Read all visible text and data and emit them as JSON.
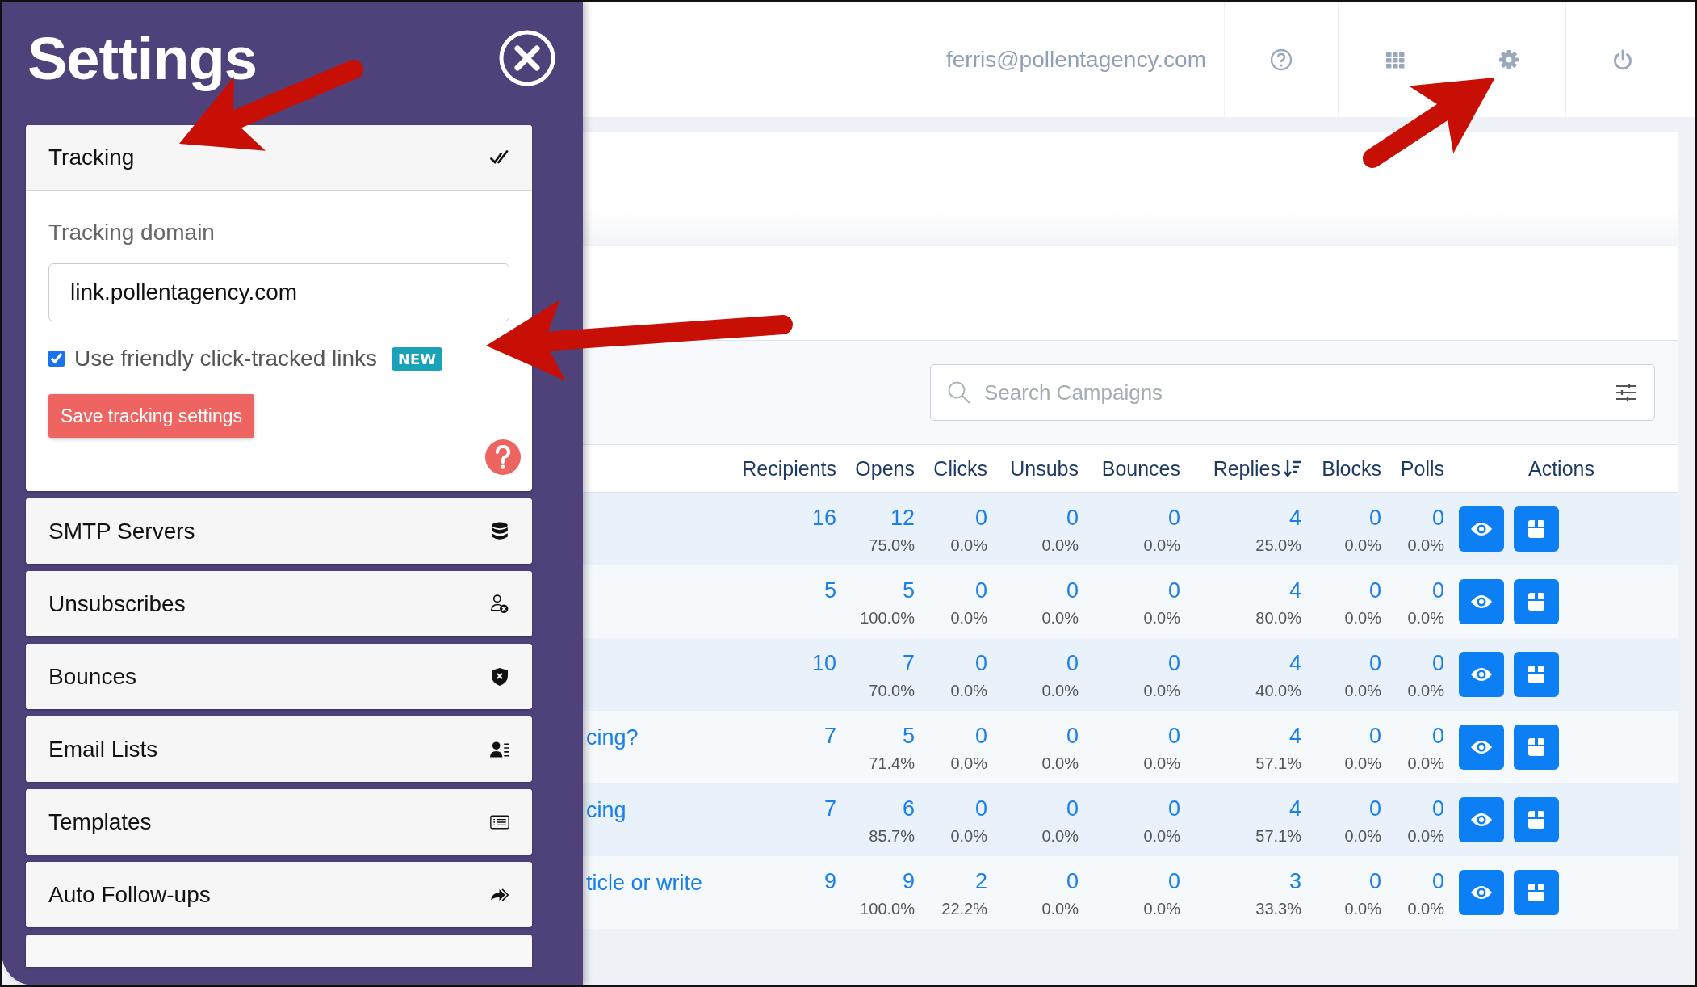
{
  "settings": {
    "title": "Settings",
    "sections": [
      {
        "label": "Tracking",
        "expanded": true,
        "body": {
          "domain_label": "Tracking domain",
          "domain_value": "link.pollentagency.com",
          "friendly_links": {
            "label": "Use friendly click-tracked links",
            "checked": true,
            "badge": "NEW"
          },
          "save_label": "Save tracking settings"
        }
      },
      {
        "label": "SMTP Servers",
        "expanded": false
      },
      {
        "label": "Unsubscribes",
        "expanded": false
      },
      {
        "label": "Bounces",
        "expanded": false
      },
      {
        "label": "Email Lists",
        "expanded": false
      },
      {
        "label": "Templates",
        "expanded": false
      },
      {
        "label": "Auto Follow-ups",
        "expanded": false
      }
    ],
    "more_below": true
  },
  "header": {
    "account_email": "ferris@pollentagency.com"
  },
  "search": {
    "placeholder": "Search Campaigns"
  },
  "table": {
    "columns": [
      {
        "label": "Recipients",
        "sorted": false
      },
      {
        "label": "Opens",
        "sorted": false
      },
      {
        "label": "Clicks",
        "sorted": false
      },
      {
        "label": "Unsubs",
        "sorted": false
      },
      {
        "label": "Bounces",
        "sorted": false
      },
      {
        "label": "Replies",
        "sorted": true
      },
      {
        "label": "Blocks",
        "sorted": false
      },
      {
        "label": "Polls",
        "sorted": false
      },
      {
        "label": "Actions",
        "sorted": false
      }
    ],
    "rows": [
      {
        "stats": [
          {
            "count": "16"
          },
          {
            "count": "12",
            "rate": "75.0%"
          },
          {
            "count": "0",
            "rate": "0.0%"
          },
          {
            "count": "0",
            "rate": "0.0%"
          },
          {
            "count": "0",
            "rate": "0.0%"
          },
          {
            "count": "4",
            "rate": "25.0%"
          },
          {
            "count": "0",
            "rate": "0.0%"
          },
          {
            "count": "0",
            "rate": "0.0%"
          }
        ]
      },
      {
        "stats": [
          {
            "count": "5"
          },
          {
            "count": "5",
            "rate": "100.0%"
          },
          {
            "count": "0",
            "rate": "0.0%"
          },
          {
            "count": "0",
            "rate": "0.0%"
          },
          {
            "count": "0",
            "rate": "0.0%"
          },
          {
            "count": "4",
            "rate": "80.0%"
          },
          {
            "count": "0",
            "rate": "0.0%"
          },
          {
            "count": "0",
            "rate": "0.0%"
          }
        ]
      },
      {
        "stats": [
          {
            "count": "10"
          },
          {
            "count": "7",
            "rate": "70.0%"
          },
          {
            "count": "0",
            "rate": "0.0%"
          },
          {
            "count": "0",
            "rate": "0.0%"
          },
          {
            "count": "0",
            "rate": "0.0%"
          },
          {
            "count": "4",
            "rate": "40.0%"
          },
          {
            "count": "0",
            "rate": "0.0%"
          },
          {
            "count": "0",
            "rate": "0.0%"
          }
        ]
      },
      {
        "name": "cing?",
        "stats": [
          {
            "count": "7"
          },
          {
            "count": "5",
            "rate": "71.4%"
          },
          {
            "count": "0",
            "rate": "0.0%"
          },
          {
            "count": "0",
            "rate": "0.0%"
          },
          {
            "count": "0",
            "rate": "0.0%"
          },
          {
            "count": "4",
            "rate": "57.1%"
          },
          {
            "count": "0",
            "rate": "0.0%"
          },
          {
            "count": "0",
            "rate": "0.0%"
          }
        ]
      },
      {
        "name": "cing",
        "stats": [
          {
            "count": "7"
          },
          {
            "count": "6",
            "rate": "85.7%"
          },
          {
            "count": "0",
            "rate": "0.0%"
          },
          {
            "count": "0",
            "rate": "0.0%"
          },
          {
            "count": "0",
            "rate": "0.0%"
          },
          {
            "count": "4",
            "rate": "57.1%"
          },
          {
            "count": "0",
            "rate": "0.0%"
          },
          {
            "count": "0",
            "rate": "0.0%"
          }
        ]
      },
      {
        "name": "ticle or write",
        "stats": [
          {
            "count": "9"
          },
          {
            "count": "9",
            "rate": "100.0%"
          },
          {
            "count": "2",
            "rate": "22.2%"
          },
          {
            "count": "0",
            "rate": "0.0%"
          },
          {
            "count": "0",
            "rate": "0.0%"
          },
          {
            "count": "3",
            "rate": "33.3%"
          },
          {
            "count": "0",
            "rate": "0.0%"
          },
          {
            "count": "0",
            "rate": "0.0%"
          }
        ]
      }
    ]
  }
}
